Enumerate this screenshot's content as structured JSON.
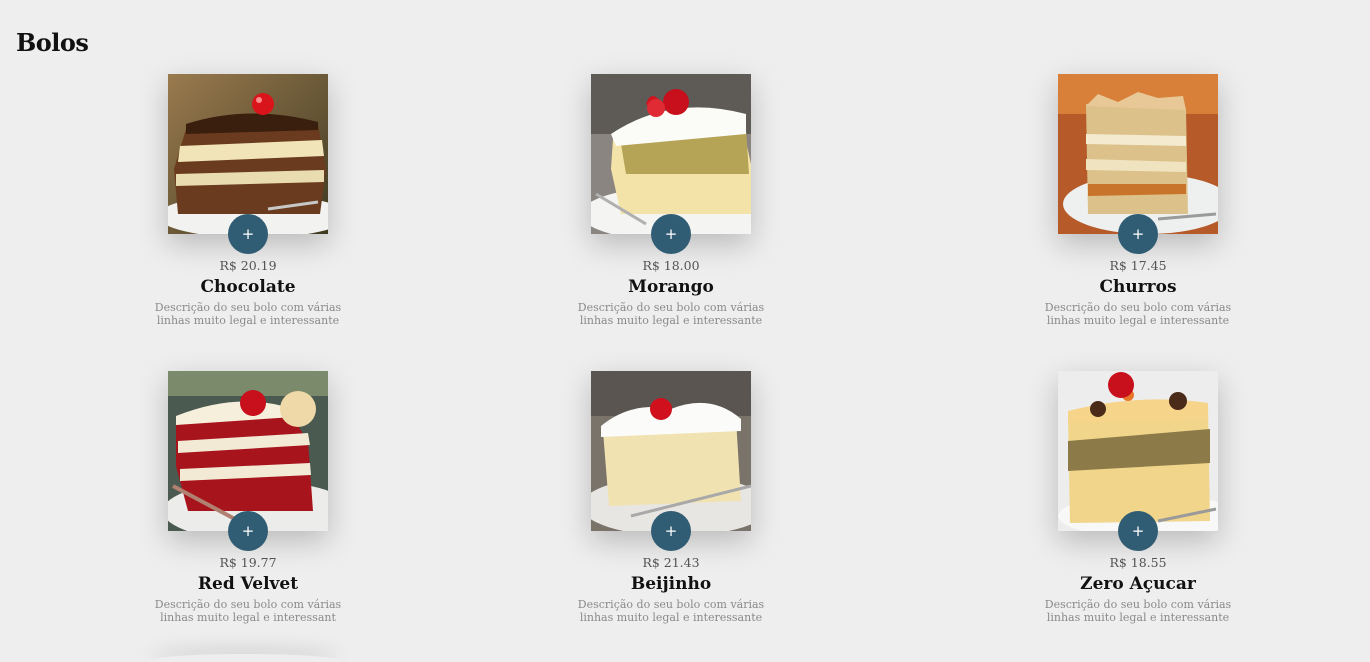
{
  "section": {
    "title": "Bolos"
  },
  "add_label": "+",
  "colors": {
    "accent": "#305d73",
    "background": "#eeeeee"
  },
  "products": [
    {
      "name": "Chocolate",
      "price": "R$ 20.19",
      "desc_line1": "Descrição do seu bolo com várias",
      "desc_line2": "linhas muito legal e interessante"
    },
    {
      "name": "Morango",
      "price": "R$ 18.00",
      "desc_line1": "Descrição do seu bolo com várias",
      "desc_line2": "linhas muito legal e interessante"
    },
    {
      "name": "Churros",
      "price": "R$ 17.45",
      "desc_line1": "Descrição do seu bolo com várias",
      "desc_line2": "linhas muito legal e interessante"
    },
    {
      "name": "Red Velvet",
      "price": "R$ 19.77",
      "desc_line1": "Descrição do seu bolo com várias",
      "desc_line2": "linhas muito legal e interessant"
    },
    {
      "name": "Beijinho",
      "price": "R$ 21.43",
      "desc_line1": "Descrição do seu bolo com várias",
      "desc_line2": "linhas muito legal e interessante"
    },
    {
      "name": "Zero Açucar",
      "price": "R$ 18.55",
      "desc_line1": "Descrição do seu bolo com várias",
      "desc_line2": "linhas muito legal e interessante"
    }
  ]
}
